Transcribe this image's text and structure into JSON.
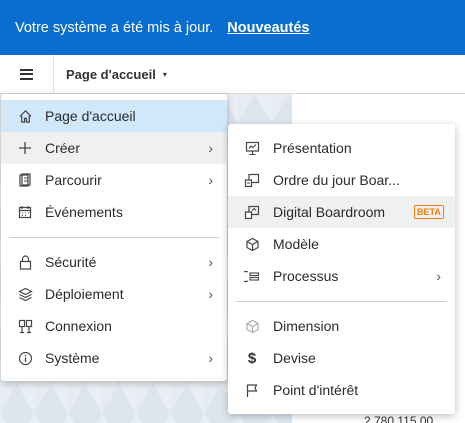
{
  "banner": {
    "message": "Votre système a été mis à jour.",
    "link": "Nouveautés"
  },
  "toolbar": {
    "page_label": "Page d'accueil",
    "caret": "▾"
  },
  "main_menu": {
    "items": [
      {
        "label": "Page d'accueil",
        "icon": "home-icon"
      },
      {
        "label": "Créer",
        "icon": "plus-icon",
        "chevron": "›"
      },
      {
        "label": "Parcourir",
        "icon": "browse-icon",
        "chevron": "›"
      },
      {
        "label": "Événements",
        "icon": "calendar-icon"
      },
      {
        "label": "Sécurité",
        "icon": "lock-icon",
        "chevron": "›"
      },
      {
        "label": "Déploiement",
        "icon": "deployment-icon",
        "chevron": "›"
      },
      {
        "label": "Connexion",
        "icon": "connection-icon"
      },
      {
        "label": "Système",
        "icon": "info-icon",
        "chevron": "›"
      }
    ]
  },
  "sub_menu": {
    "items": [
      {
        "label": "Présentation",
        "icon": "presentation-icon"
      },
      {
        "label": "Ordre du jour Boar...",
        "icon": "agenda-icon"
      },
      {
        "label": "Digital Boardroom",
        "icon": "boardroom-icon",
        "badge": "BETA"
      },
      {
        "label": "Modèle",
        "icon": "cube-icon"
      },
      {
        "label": "Processus",
        "icon": "process-icon",
        "chevron": "›"
      },
      {
        "label": "Dimension",
        "icon": "dimension-icon"
      },
      {
        "label": "Devise",
        "icon": "currency-icon",
        "symbol": "$"
      },
      {
        "label": "Point d'intérêt",
        "icon": "flag-icon"
      }
    ]
  },
  "background": {
    "value": "2 780 115,00"
  }
}
